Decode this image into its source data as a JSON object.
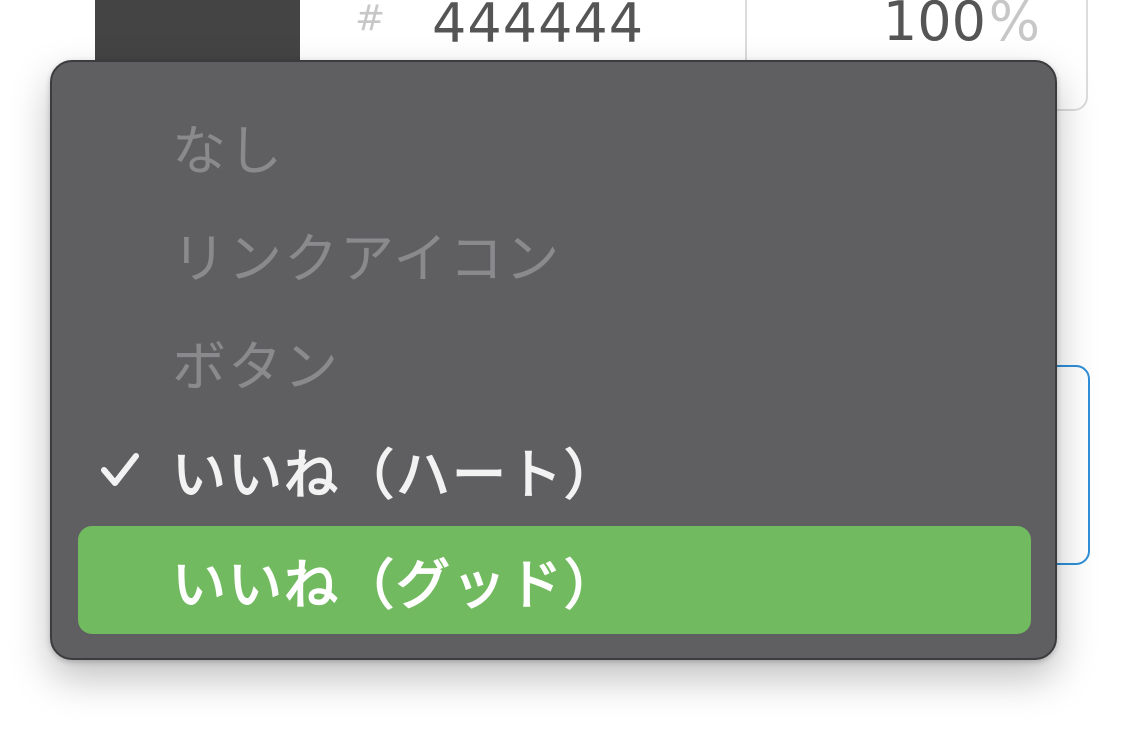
{
  "color_input": {
    "swatch_color": "#444444",
    "hash_symbol": "#",
    "hex_value": "444444",
    "opacity_value": "100",
    "opacity_unit": "%"
  },
  "dropdown": {
    "items": [
      {
        "label": "なし",
        "state": "disabled"
      },
      {
        "label": "リンクアイコン",
        "state": "disabled"
      },
      {
        "label": "ボタン",
        "state": "disabled"
      },
      {
        "label": "いいね（ハート）",
        "state": "checked"
      },
      {
        "label": "いいね（グッド）",
        "state": "highlighted"
      }
    ],
    "colors": {
      "menu_background": "#5f5f62",
      "highlight": "#72ba60",
      "focus_border": "#2f8fd8"
    },
    "icons": {
      "checked_item": "checkmark-icon"
    }
  }
}
